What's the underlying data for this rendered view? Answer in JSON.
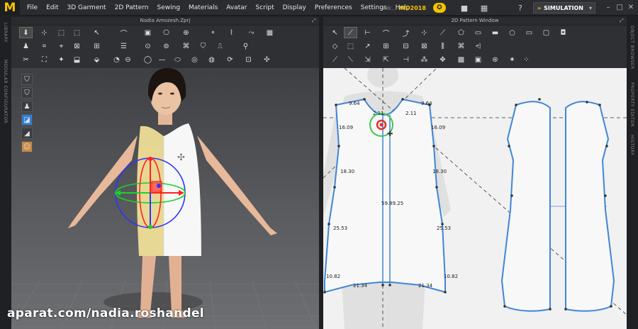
{
  "app": {
    "logo_letter": "M"
  },
  "menu": [
    "File",
    "Edit",
    "3D Garment",
    "2D Pattern",
    "Sewing",
    "Materials",
    "Avatar",
    "Script",
    "Display",
    "Preferences",
    "Settings",
    "Help"
  ],
  "edition": {
    "prefix": "nik...",
    "name": "iND2018"
  },
  "simulation": {
    "label": "SIMULATION"
  },
  "window_controls": [
    "–",
    "□",
    "✕"
  ],
  "left_sidebar": {
    "tab1": "LIBRARY",
    "tab2": "MODULAR CONFIGURATOR"
  },
  "right_sidebar": {
    "tab1": "OBJECT BROWSER",
    "tab2": "PROPERTY EDITOR",
    "tab3": "HISTORY"
  },
  "panel3d": {
    "title": "Nadia Amozesh.Zprj"
  },
  "panel2d": {
    "title": "2D Pattern Window"
  },
  "measurements": {
    "m1": "9.64",
    "m2": "9.64",
    "m3": "16.09",
    "m4": "16.09",
    "m5": "18.30",
    "m6": "18.30",
    "m7": "25.53",
    "m8": "25.53",
    "m9": "10.82",
    "m10": "10.82",
    "m11": "21.34",
    "m12": "21.34",
    "m13": "2.11",
    "m14": "2.11",
    "m15": "59.89.25"
  },
  "watermark": "aparat.com/nadia.roshandel"
}
